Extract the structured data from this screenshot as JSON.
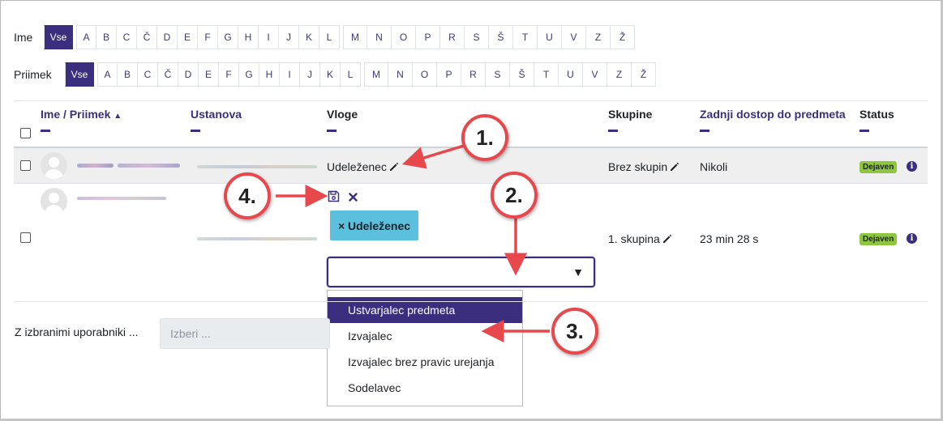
{
  "filters": {
    "first_name": {
      "label": "Ime",
      "all": "Vse",
      "groups": [
        [
          "A",
          "B",
          "C",
          "Č",
          "D",
          "E",
          "F",
          "G",
          "H",
          "I",
          "J",
          "K",
          "L"
        ],
        [
          "M",
          "N",
          "O",
          "P",
          "R",
          "S",
          "Š",
          "T",
          "U",
          "V",
          "Z",
          "Ž"
        ]
      ]
    },
    "last_name": {
      "label": "Priimek",
      "all": "Vse",
      "groups": [
        [
          "A",
          "B",
          "C",
          "Č",
          "D",
          "E",
          "F",
          "G",
          "H",
          "I",
          "J",
          "K",
          "L"
        ],
        [
          "M",
          "N",
          "O",
          "P",
          "R",
          "S",
          "Š",
          "T",
          "U",
          "V",
          "Z",
          "Ž"
        ]
      ]
    }
  },
  "table": {
    "headers": {
      "name": "Ime / Priimek",
      "institution": "Ustanova",
      "roles": "Vloge",
      "groups": "Skupine",
      "last_access": "Zadnji dostop do predmeta",
      "status": "Status"
    },
    "rows": [
      {
        "role": "Udeleženec",
        "groups": "Brez skupin",
        "last_access": "Nikoli",
        "status": "Dejaven"
      },
      {
        "role_tag": "× Udeleženec",
        "groups": "1. skupina",
        "last_access": "23 min 28 s",
        "status": "Dejaven"
      }
    ]
  },
  "role_dropdown": {
    "caret": "▼",
    "options": [
      "Ustvarjalec predmeta",
      "Izvajalec",
      "Izvajalec brez pravic urejanja",
      "Sodelavec"
    ],
    "selected_index": 0
  },
  "bulk": {
    "label": "Z izbranimi uporabniki ...",
    "placeholder": "Izberi ..."
  },
  "callouts": [
    "1.",
    "2.",
    "3.",
    "4."
  ],
  "colors": {
    "accent": "#3b2e7e",
    "callout": "#e8484c",
    "badge": "#8ec63f",
    "tag": "#5bc0de"
  }
}
